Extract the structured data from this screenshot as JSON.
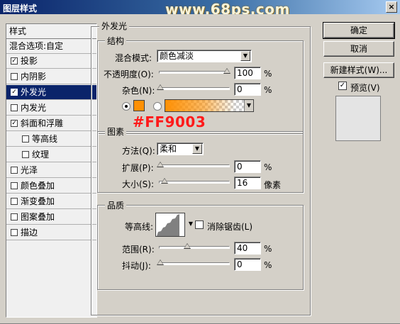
{
  "window": {
    "title": "图层样式",
    "watermark": "www.68ps.com",
    "close": "×"
  },
  "stylelist": {
    "header": "样式",
    "blend_options": "混合选项:自定",
    "items": [
      {
        "label": "投影",
        "checked": true,
        "check": "✓",
        "indent": false
      },
      {
        "label": "内阴影",
        "checked": false,
        "check": "",
        "indent": false
      },
      {
        "label": "外发光",
        "checked": true,
        "check": "✓",
        "indent": false,
        "selected": true
      },
      {
        "label": "内发光",
        "checked": false,
        "check": "",
        "indent": false
      },
      {
        "label": "斜面和浮雕",
        "checked": true,
        "check": "✓",
        "indent": false
      },
      {
        "label": "等高线",
        "checked": false,
        "check": "",
        "indent": true
      },
      {
        "label": "纹理",
        "checked": false,
        "check": "",
        "indent": true
      },
      {
        "label": "光泽",
        "checked": false,
        "check": "",
        "indent": false
      },
      {
        "label": "颜色叠加",
        "checked": false,
        "check": "",
        "indent": false
      },
      {
        "label": "渐变叠加",
        "checked": false,
        "check": "",
        "indent": false
      },
      {
        "label": "图案叠加",
        "checked": false,
        "check": "",
        "indent": false
      },
      {
        "label": "描边",
        "checked": false,
        "check": "",
        "indent": false
      }
    ]
  },
  "outer_glow": {
    "title": "外发光",
    "structure": {
      "title": "结构",
      "blend_mode_label": "混合模式:",
      "blend_mode_value": "颜色减淡",
      "opacity_label": "不透明度(O):",
      "opacity_value": "100",
      "opacity_unit": "%",
      "opacity_fraction": 1.0,
      "noise_label": "杂色(N):",
      "noise_value": "0",
      "noise_unit": "%",
      "noise_fraction": 0.0,
      "glow_color": "#FF9003"
    },
    "elements": {
      "title": "图素",
      "method_label": "方法(Q):",
      "method_value": "柔和",
      "spread_label": "扩展(P):",
      "spread_value": "0",
      "spread_unit": "%",
      "spread_fraction": 0.0,
      "size_label": "大小(S):",
      "size_value": "16",
      "size_unit": "像素",
      "size_fraction": 0.06
    },
    "quality": {
      "title": "品质",
      "contour_label": "等高线:",
      "antialias_label": "消除锯齿(L)",
      "range_label": "范围(R):",
      "range_value": "40",
      "range_unit": "%",
      "range_fraction": 0.4,
      "jitter_label": "抖动(J):",
      "jitter_value": "0",
      "jitter_unit": "%",
      "jitter_fraction": 0.0
    }
  },
  "annotation": "#FF9003",
  "buttons": {
    "ok": "确定",
    "cancel": "取消",
    "new_style": "新建样式(W)...",
    "preview_label": "预览(V)",
    "preview_check": "✓"
  },
  "colors": {
    "accent": "#0a246a",
    "glow": "#FF9003",
    "annotation": "#ff1a1a"
  }
}
